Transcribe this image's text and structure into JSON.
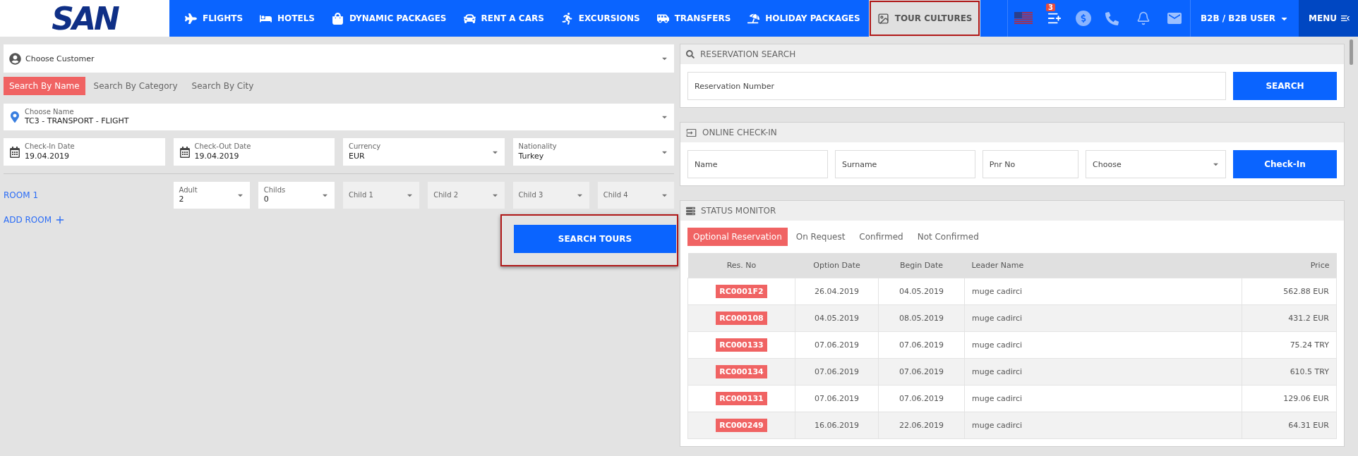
{
  "header": {
    "logo": "SAN",
    "nav": [
      {
        "label": "FLIGHTS",
        "selected": false
      },
      {
        "label": "HOTELS",
        "selected": false
      },
      {
        "label": "DYNAMIC PACKAGES",
        "selected": false
      },
      {
        "label": "RENT A CARS",
        "selected": false
      },
      {
        "label": "EXCURSIONS",
        "selected": false
      },
      {
        "label": "TRANSFERS",
        "selected": false
      },
      {
        "label": "HOLIDAY PACKAGES",
        "selected": false
      },
      {
        "label": "TOUR CULTURES",
        "selected": true
      }
    ],
    "notification_count": "3",
    "user_menu": "B2B / B2B USER",
    "menu": "MENU"
  },
  "search_form": {
    "customer": {
      "placeholder": "Choose Customer"
    },
    "tabs": [
      {
        "label": "Search By Name",
        "selected": true
      },
      {
        "label": "Search By Category",
        "selected": false
      },
      {
        "label": "Search By City",
        "selected": false
      }
    ],
    "name_select": {
      "label": "Choose Name",
      "value": "TC3 - TRANSPORT - FLIGHT"
    },
    "fields": [
      {
        "label": "Check-In Date",
        "value": "19.04.2019",
        "kind": "date"
      },
      {
        "label": "Check-Out Date",
        "value": "19.04.2019",
        "kind": "date"
      },
      {
        "label": "Currency",
        "value": "EUR",
        "kind": "select"
      },
      {
        "label": "Nationality",
        "value": "Turkey",
        "kind": "select"
      }
    ],
    "room": {
      "title": "ROOM 1",
      "selects": [
        {
          "label": "Adult",
          "value": "2",
          "disabled": false
        },
        {
          "label": "Childs",
          "value": "0",
          "disabled": false
        },
        {
          "label": "Child 1",
          "disabled": true
        },
        {
          "label": "Child 2",
          "disabled": true
        },
        {
          "label": "Child 3",
          "disabled": true
        },
        {
          "label": "Child 4",
          "disabled": true
        }
      ]
    },
    "add_room": "ADD ROOM",
    "search_button": {
      "label": "SEARCH TOURS",
      "highlighted": true
    }
  },
  "reservation_search": {
    "title": "RESERVATION SEARCH",
    "placeholder": "Reservation Number",
    "button": "SEARCH"
  },
  "online_checkin": {
    "title": "ONLINE CHECK-IN",
    "fields": [
      {
        "placeholder": "Name",
        "kind": "input"
      },
      {
        "placeholder": "Surname",
        "kind": "input"
      },
      {
        "placeholder": "Pnr No",
        "kind": "input"
      },
      {
        "placeholder": "Choose",
        "kind": "select"
      }
    ],
    "button": "Check-In"
  },
  "status_monitor": {
    "title": "STATUS MONITOR",
    "tabs": [
      {
        "label": "Optional Reservation",
        "selected": true
      },
      {
        "label": "On Request",
        "selected": false
      },
      {
        "label": "Confirmed",
        "selected": false
      },
      {
        "label": "Not Confirmed",
        "selected": false
      }
    ],
    "table": {
      "columns": [
        "Res. No",
        "Option Date",
        "Begin Date",
        "Leader Name",
        "Price"
      ],
      "rows": [
        [
          "RC0001F2",
          "26.04.2019",
          "04.05.2019",
          "muge cadirci",
          "562.88 EUR"
        ],
        [
          "RC000108",
          "04.05.2019",
          "08.05.2019",
          "muge cadirci",
          "431.2 EUR"
        ],
        [
          "RC000133",
          "07.06.2019",
          "07.06.2019",
          "muge cadirci",
          "75.24 TRY"
        ],
        [
          "RC000134",
          "07.06.2019",
          "07.06.2019",
          "muge cadirci",
          "610.5 TRY"
        ],
        [
          "RC000131",
          "07.06.2019",
          "07.06.2019",
          "muge cadirci",
          "129.06 EUR"
        ],
        [
          "RC000249",
          "16.06.2019",
          "22.06.2019",
          "muge cadirci",
          "64.31 EUR"
        ]
      ]
    }
  }
}
